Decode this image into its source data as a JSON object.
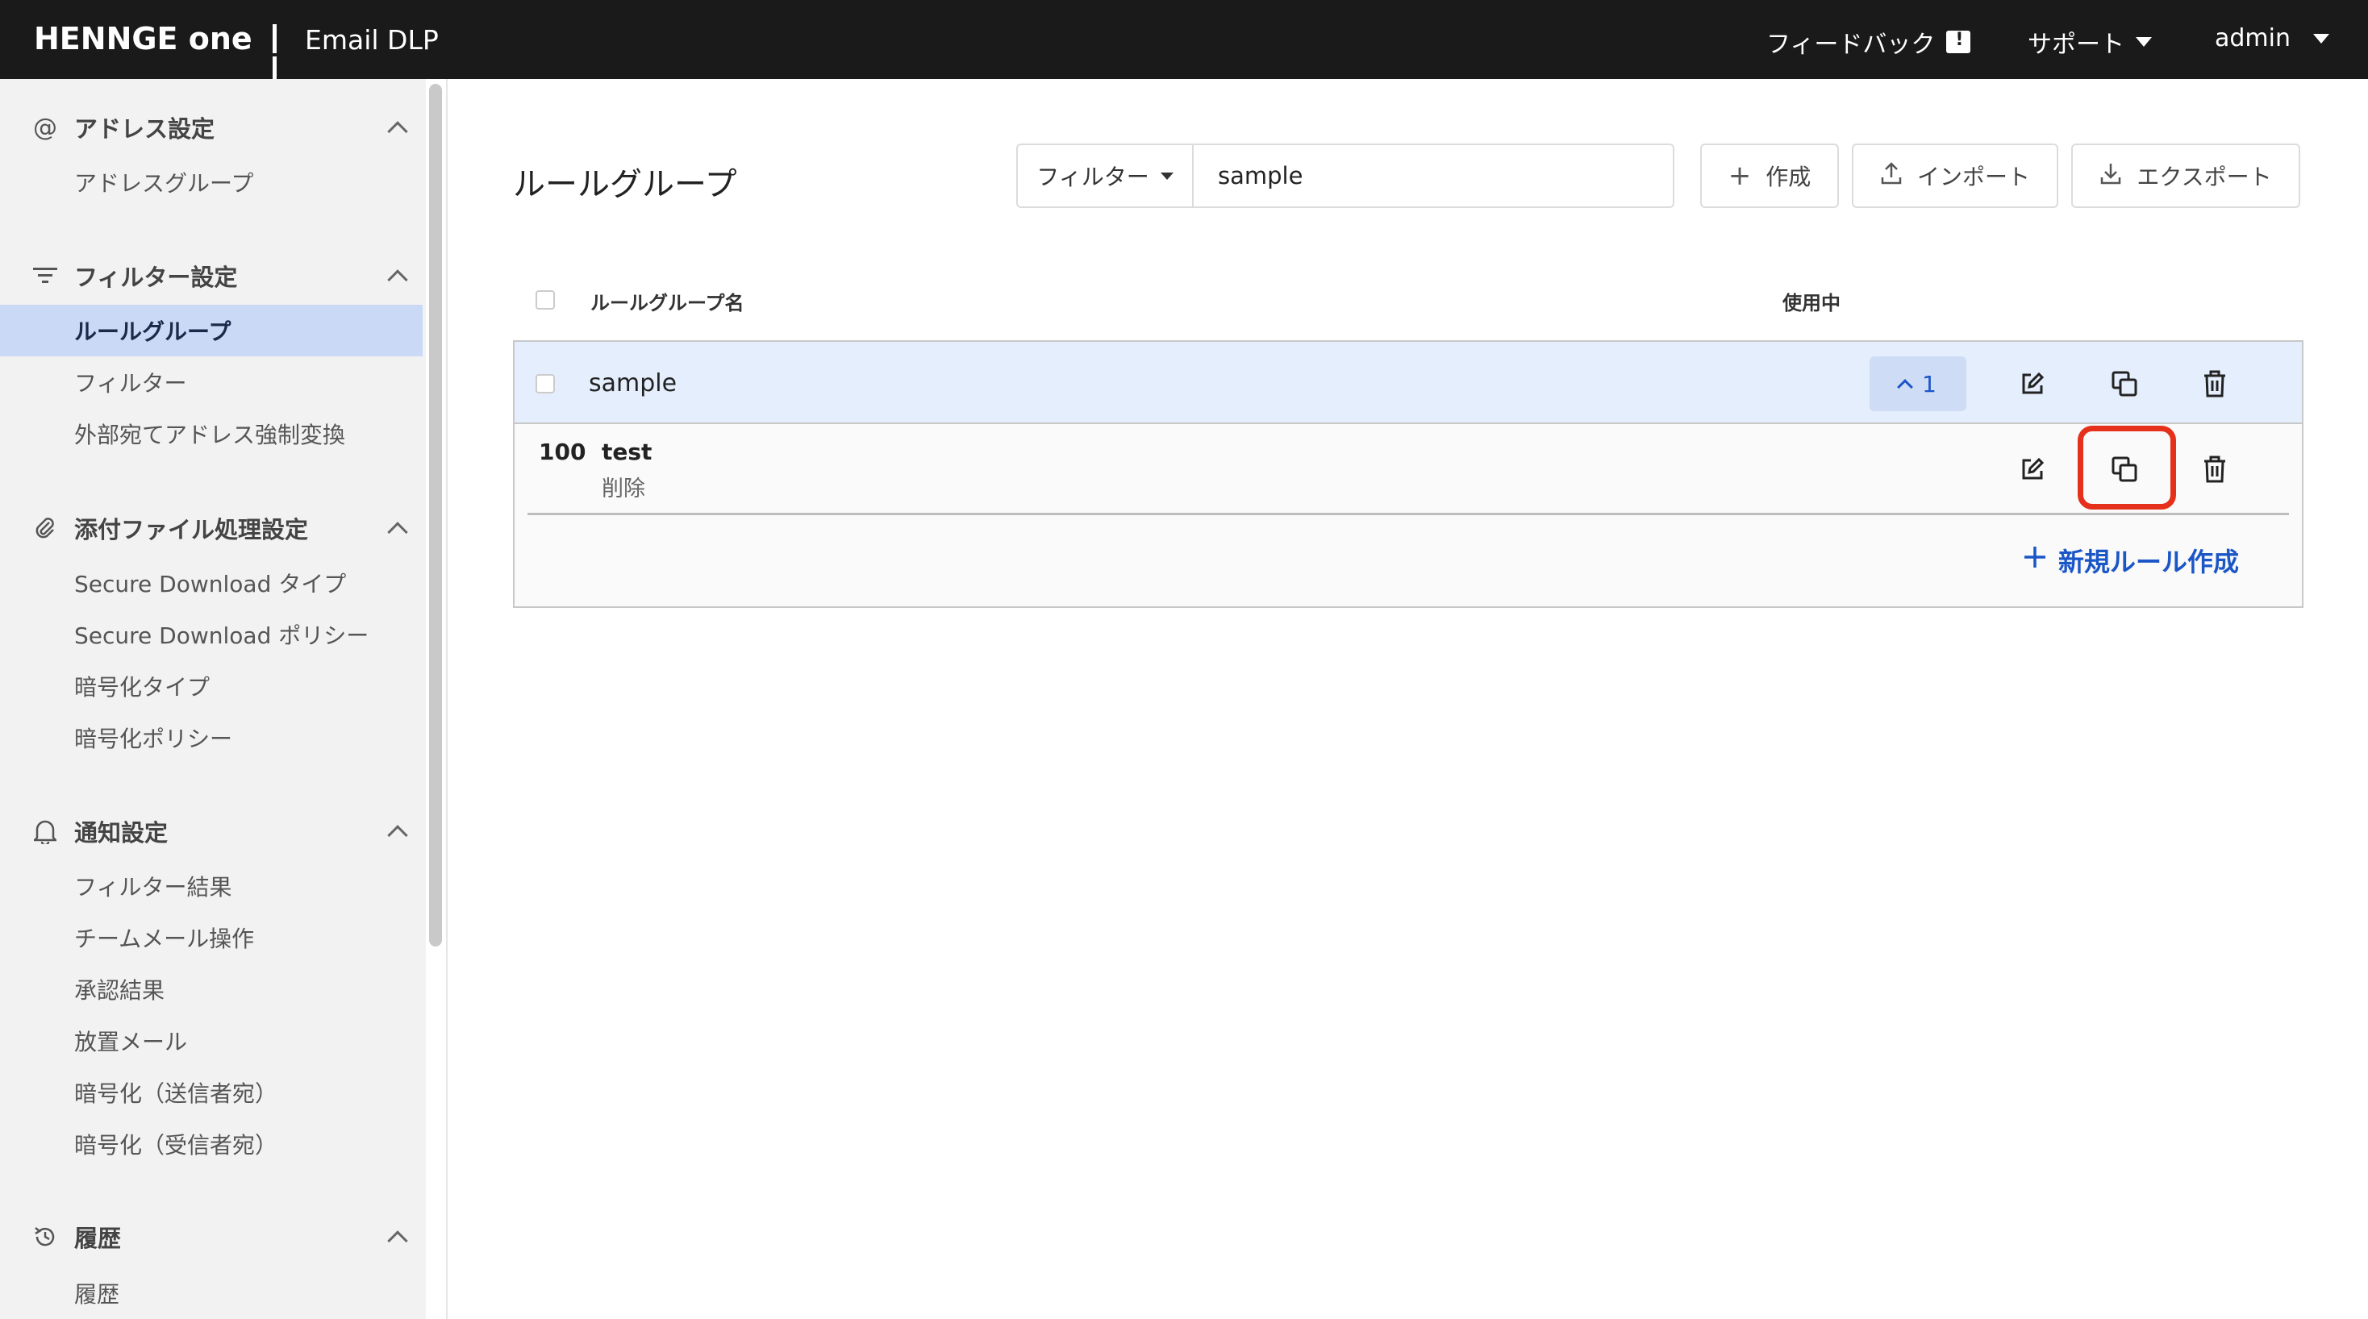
{
  "header": {
    "logo": "HENNGE one",
    "app_name": "Email DLP",
    "feedback": "フィードバック",
    "support": "サポート",
    "user": "admin"
  },
  "sidebar": {
    "sections": [
      {
        "icon": "at-icon",
        "title": "アドレス設定",
        "items": [
          "アドレスグループ"
        ]
      },
      {
        "icon": "filter-icon",
        "title": "フィルター設定",
        "items": [
          "ルールグループ",
          "フィルター",
          "外部宛てアドレス強制変換"
        ]
      },
      {
        "icon": "paperclip-icon",
        "title": "添付ファイル処理設定",
        "items": [
          "Secure Download タイプ",
          "Secure Download ポリシー",
          "暗号化タイプ",
          "暗号化ポリシー"
        ]
      },
      {
        "icon": "bell-icon",
        "title": "通知設定",
        "items": [
          "フィルター結果",
          "チームメール操作",
          "承認結果",
          "放置メール",
          "暗号化（送信者宛）",
          "暗号化（受信者宛）"
        ]
      },
      {
        "icon": "history-icon",
        "title": "履歴",
        "items": [
          "履歴"
        ]
      }
    ],
    "active_item": "ルールグループ"
  },
  "main": {
    "page_title": "ルールグループ",
    "filter": {
      "select_label": "フィルター",
      "value": "sample"
    },
    "buttons": {
      "create": "作成",
      "import": "インポート",
      "export": "エクスポート"
    },
    "columns": {
      "name": "ルールグループ名",
      "in_use": "使用中"
    },
    "group": {
      "name": "sample",
      "count": "1"
    },
    "rule": {
      "priority": "100",
      "name": "test",
      "action": "削除"
    },
    "new_rule": "新規ルール作成"
  },
  "colors": {
    "header_bg": "#1a1a1a",
    "accent": "#1b56c7",
    "highlight": "#e5311c",
    "active_nav": "#c9d9f6"
  }
}
